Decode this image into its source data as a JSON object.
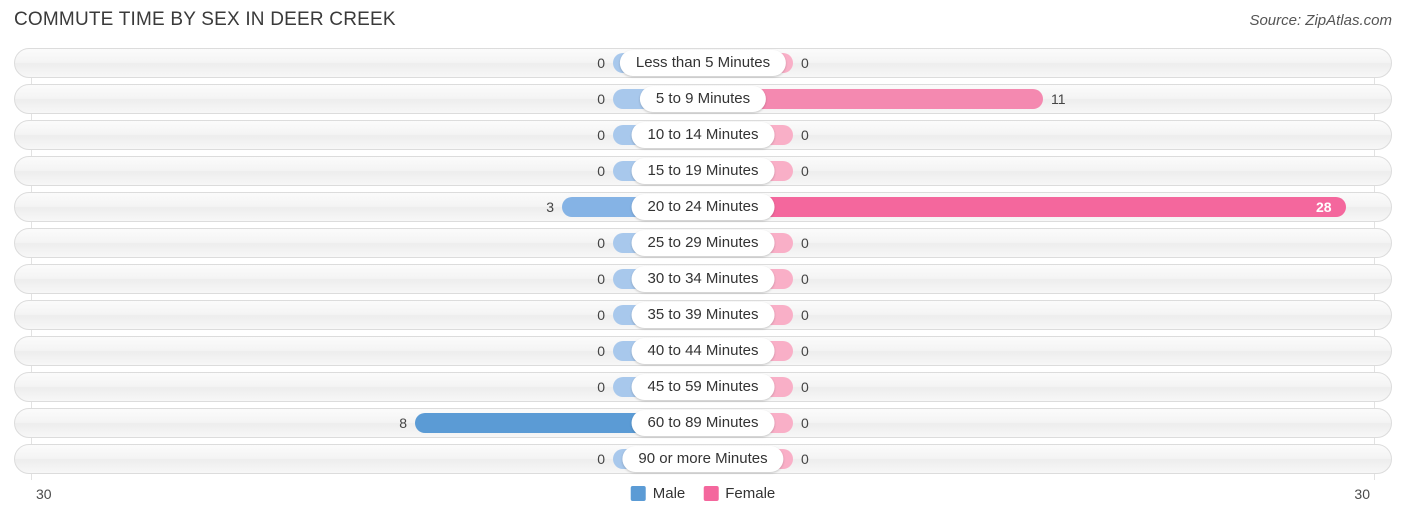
{
  "header": {
    "title": "COMMUTE TIME BY SEX IN DEER CREEK",
    "source": "Source: ZipAtlas.com"
  },
  "legend": {
    "male_label": "Male",
    "female_label": "Female",
    "male_color": "#5b9bd5",
    "female_color": "#f4679d"
  },
  "axis": {
    "left_max": "30",
    "right_max": "30"
  },
  "chart_data": {
    "type": "bar",
    "orientation": "horizontal-diverging",
    "title": "COMMUTE TIME BY SEX IN DEER CREEK",
    "xlabel": "",
    "ylabel": "",
    "xlim": [
      30,
      30
    ],
    "grid": true,
    "legend_position": "bottom-center",
    "categories": [
      "Less than 5 Minutes",
      "5 to 9 Minutes",
      "10 to 14 Minutes",
      "15 to 19 Minutes",
      "20 to 24 Minutes",
      "25 to 29 Minutes",
      "30 to 34 Minutes",
      "35 to 39 Minutes",
      "40 to 44 Minutes",
      "45 to 59 Minutes",
      "60 to 89 Minutes",
      "90 or more Minutes"
    ],
    "series": [
      {
        "name": "Male",
        "values": [
          0,
          0,
          0,
          0,
          3,
          0,
          0,
          0,
          0,
          0,
          8,
          0
        ]
      },
      {
        "name": "Female",
        "values": [
          0,
          11,
          0,
          0,
          28,
          0,
          0,
          0,
          0,
          0,
          0,
          0
        ]
      }
    ]
  },
  "rows": [
    {
      "label": "Less than 5 Minutes",
      "male": "0",
      "female": "0",
      "male_w": 90,
      "female_w": 90,
      "male_color": "#a8c8ec",
      "female_color": "#f9afc7",
      "female_inside": false
    },
    {
      "label": "5 to 9 Minutes",
      "male": "0",
      "female": "11",
      "male_w": 90,
      "female_w": 340,
      "male_color": "#a8c8ec",
      "female_color": "#f489b0",
      "female_inside": false
    },
    {
      "label": "10 to 14 Minutes",
      "male": "0",
      "female": "0",
      "male_w": 90,
      "female_w": 90,
      "male_color": "#a8c8ec",
      "female_color": "#f9afc7",
      "female_inside": false
    },
    {
      "label": "15 to 19 Minutes",
      "male": "0",
      "female": "0",
      "male_w": 90,
      "female_w": 90,
      "male_color": "#a8c8ec",
      "female_color": "#f9afc7",
      "female_inside": false
    },
    {
      "label": "20 to 24 Minutes",
      "male": "3",
      "female": "28",
      "male_w": 141,
      "female_w": 643,
      "male_color": "#85b3e5",
      "female_color": "#f4679d",
      "female_inside": true
    },
    {
      "label": "25 to 29 Minutes",
      "male": "0",
      "female": "0",
      "male_w": 90,
      "female_w": 90,
      "male_color": "#a8c8ec",
      "female_color": "#f9afc7",
      "female_inside": false
    },
    {
      "label": "30 to 34 Minutes",
      "male": "0",
      "female": "0",
      "male_w": 90,
      "female_w": 90,
      "male_color": "#a8c8ec",
      "female_color": "#f9afc7",
      "female_inside": false
    },
    {
      "label": "35 to 39 Minutes",
      "male": "0",
      "female": "0",
      "male_w": 90,
      "female_w": 90,
      "male_color": "#a8c8ec",
      "female_color": "#f9afc7",
      "female_inside": false
    },
    {
      "label": "40 to 44 Minutes",
      "male": "0",
      "female": "0",
      "male_w": 90,
      "female_w": 90,
      "male_color": "#a8c8ec",
      "female_color": "#f9afc7",
      "female_inside": false
    },
    {
      "label": "45 to 59 Minutes",
      "male": "0",
      "female": "0",
      "male_w": 90,
      "female_w": 90,
      "male_color": "#a8c8ec",
      "female_color": "#f9afc7",
      "female_inside": false
    },
    {
      "label": "60 to 89 Minutes",
      "male": "8",
      "female": "0",
      "male_w": 288,
      "female_w": 90,
      "male_color": "#5b9bd5",
      "female_color": "#f9afc7",
      "female_inside": false
    },
    {
      "label": "90 or more Minutes",
      "male": "0",
      "female": "0",
      "male_w": 90,
      "female_w": 90,
      "male_color": "#a8c8ec",
      "female_color": "#f9afc7",
      "female_inside": false
    }
  ]
}
